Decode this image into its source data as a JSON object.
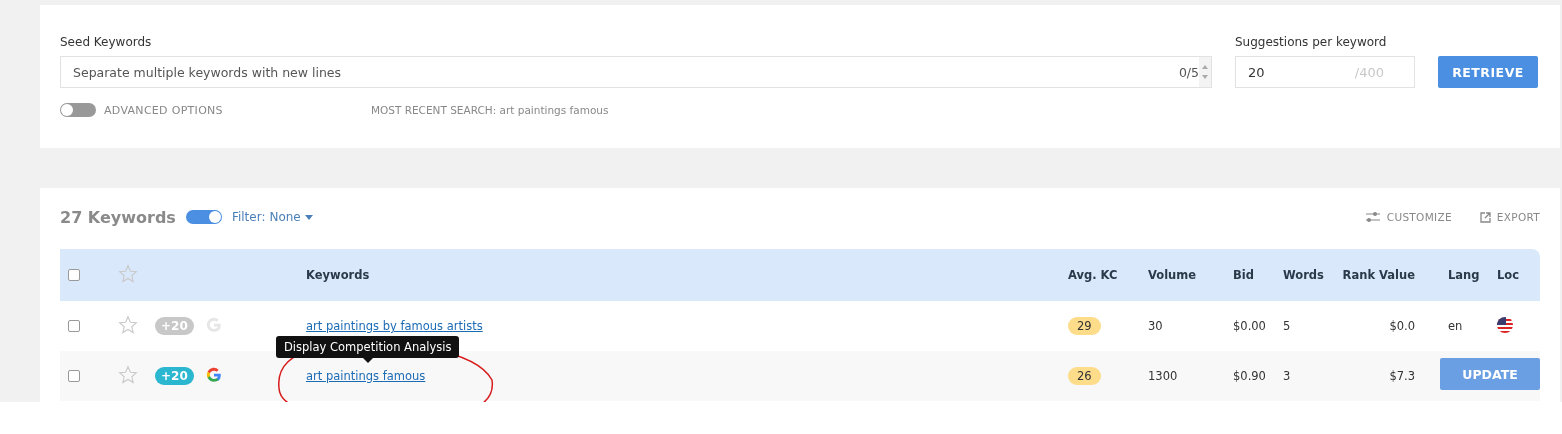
{
  "search_panel": {
    "seed_label": "Seed Keywords",
    "seed_placeholder": "Separate multiple keywords with new lines",
    "seed_counter": "0/5",
    "suggestions_label": "Suggestions per keyword",
    "suggestions_value": "20",
    "suggestions_max": "/400",
    "retrieve_button": "RETRIEVE",
    "advanced_toggle": {
      "label": "ADVANCED OPTIONS",
      "on": false
    },
    "recent_search": "MOST RECENT SEARCH: art paintings famous"
  },
  "results": {
    "count_title": "27 Keywords",
    "toggle_on": true,
    "filter_label": "Filter:",
    "filter_value": "None",
    "customize": "CUSTOMIZE",
    "export": "EXPORT",
    "table": {
      "select_all_checked": false,
      "columns": [
        "Keywords",
        "Avg. KC",
        "Volume",
        "Bid",
        "Words",
        "Rank Value",
        "Lang",
        "Loc"
      ],
      "rows": [
        {
          "checked": false,
          "starred": false,
          "badge": "+20",
          "active": false,
          "keyword": "art paintings by famous artists",
          "avg_kc": "29",
          "volume": "30",
          "bid": "$0.00",
          "words": "5",
          "rank_value": "$0.0",
          "lang": "en"
        },
        {
          "checked": false,
          "starred": false,
          "badge": "+20",
          "active": true,
          "keyword": "art paintings famous",
          "avg_kc": "26",
          "volume": "1300",
          "bid": "$0.90",
          "words": "3",
          "rank_value": "$7.3"
        }
      ]
    },
    "tooltip": "Display Competition Analysis",
    "update_button": "UPDATE"
  }
}
